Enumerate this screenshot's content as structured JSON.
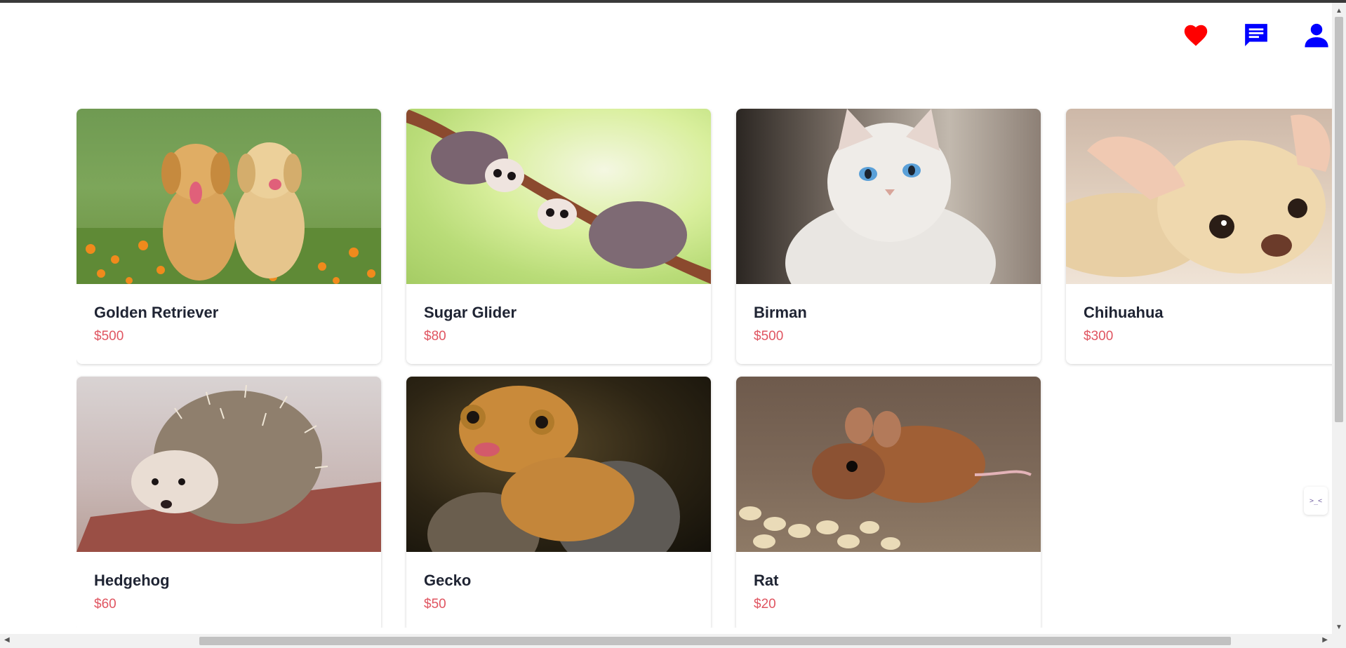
{
  "header": {
    "icons": [
      "heart-icon",
      "chat-icon",
      "user-icon"
    ],
    "colors": {
      "heart": "#ff0000",
      "chat": "#0000ff",
      "user": "#0000ff"
    }
  },
  "pets": [
    {
      "name": "Golden Retriever",
      "price": "$500",
      "image": "golden-retriever-puppies"
    },
    {
      "name": "Sugar Glider",
      "price": "$80",
      "image": "sugar-gliders-on-branch"
    },
    {
      "name": "Birman",
      "price": "$500",
      "image": "white-birman-cat"
    },
    {
      "name": "Chihuahua",
      "price": "$300",
      "image": "chihuahua-lying"
    },
    {
      "name": "Hedgehog",
      "price": "$60",
      "image": "hedgehog"
    },
    {
      "name": "Gecko",
      "price": "$50",
      "image": "crested-gecko"
    },
    {
      "name": "Rat",
      "price": "$20",
      "image": "mouse-eating-nuts"
    }
  ],
  "widget": {
    "label": ">_<"
  },
  "colors": {
    "name_text": "#1f2433",
    "price_text": "#e05561",
    "top_border": "#3a3a3a"
  }
}
